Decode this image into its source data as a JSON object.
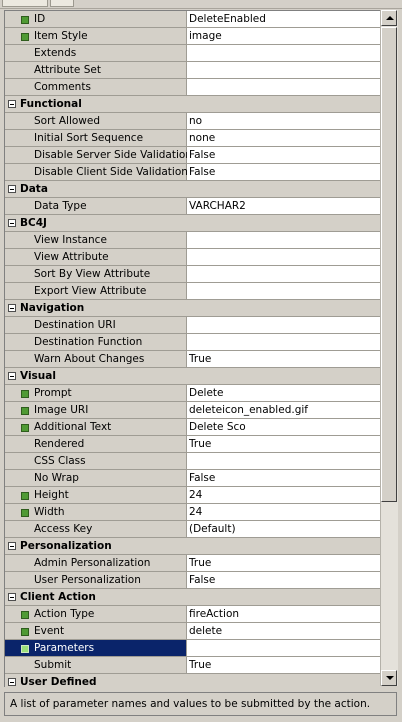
{
  "inspector": {
    "groups": [
      {
        "title": "",
        "rows": [
          {
            "label": "ID",
            "value": "DeleteEnabled",
            "marked": true
          },
          {
            "label": "Item Style",
            "value": "image",
            "marked": true
          },
          {
            "label": "Extends",
            "value": "",
            "marked": false
          },
          {
            "label": "Attribute Set",
            "value": "",
            "marked": false
          },
          {
            "label": "Comments",
            "value": "",
            "marked": false
          }
        ]
      },
      {
        "title": "Functional",
        "rows": [
          {
            "label": "Sort Allowed",
            "value": "no",
            "marked": false
          },
          {
            "label": "Initial Sort Sequence",
            "value": "none",
            "marked": false
          },
          {
            "label": "Disable Server Side Validation",
            "value": "False",
            "marked": false
          },
          {
            "label": "Disable Client Side Validation",
            "value": "False",
            "marked": false
          }
        ]
      },
      {
        "title": "Data",
        "rows": [
          {
            "label": "Data Type",
            "value": "VARCHAR2",
            "marked": false
          }
        ]
      },
      {
        "title": "BC4J",
        "rows": [
          {
            "label": "View Instance",
            "value": "",
            "marked": false
          },
          {
            "label": "View Attribute",
            "value": "",
            "marked": false
          },
          {
            "label": "Sort By View Attribute",
            "value": "",
            "marked": false
          },
          {
            "label": "Export View Attribute",
            "value": "",
            "marked": false
          }
        ]
      },
      {
        "title": "Navigation",
        "rows": [
          {
            "label": "Destination URI",
            "value": "",
            "marked": false
          },
          {
            "label": "Destination Function",
            "value": "",
            "marked": false
          },
          {
            "label": "Warn About Changes",
            "value": "True",
            "marked": false
          }
        ]
      },
      {
        "title": "Visual",
        "rows": [
          {
            "label": "Prompt",
            "value": "Delete",
            "marked": true
          },
          {
            "label": "Image URI",
            "value": "deleteicon_enabled.gif",
            "marked": true
          },
          {
            "label": "Additional Text",
            "value": "Delete Sco",
            "marked": true
          },
          {
            "label": "Rendered",
            "value": "True",
            "marked": false
          },
          {
            "label": "CSS Class",
            "value": "",
            "marked": false
          },
          {
            "label": "No Wrap",
            "value": "False",
            "marked": false
          },
          {
            "label": "Height",
            "value": "24",
            "marked": true
          },
          {
            "label": "Width",
            "value": "24",
            "marked": true
          },
          {
            "label": "Access Key",
            "value": "(Default)",
            "marked": false
          }
        ]
      },
      {
        "title": "Personalization",
        "rows": [
          {
            "label": "Admin Personalization",
            "value": "True",
            "marked": false
          },
          {
            "label": "User Personalization",
            "value": "False",
            "marked": false
          }
        ]
      },
      {
        "title": "Client Action",
        "rows": [
          {
            "label": "Action Type",
            "value": "fireAction",
            "marked": true
          },
          {
            "label": "Event",
            "value": "delete",
            "marked": true
          },
          {
            "label": "Parameters",
            "value": "",
            "marked": true,
            "selected": true
          },
          {
            "label": "Submit",
            "value": "True",
            "marked": false
          }
        ]
      },
      {
        "title": "User Defined",
        "rows": []
      }
    ]
  },
  "status": {
    "text": "A list of parameter names and values to be submitted by the action."
  },
  "colors": {
    "selection": "#0a246a",
    "marker": "#4f9a34",
    "panel": "#d4d0c8"
  }
}
